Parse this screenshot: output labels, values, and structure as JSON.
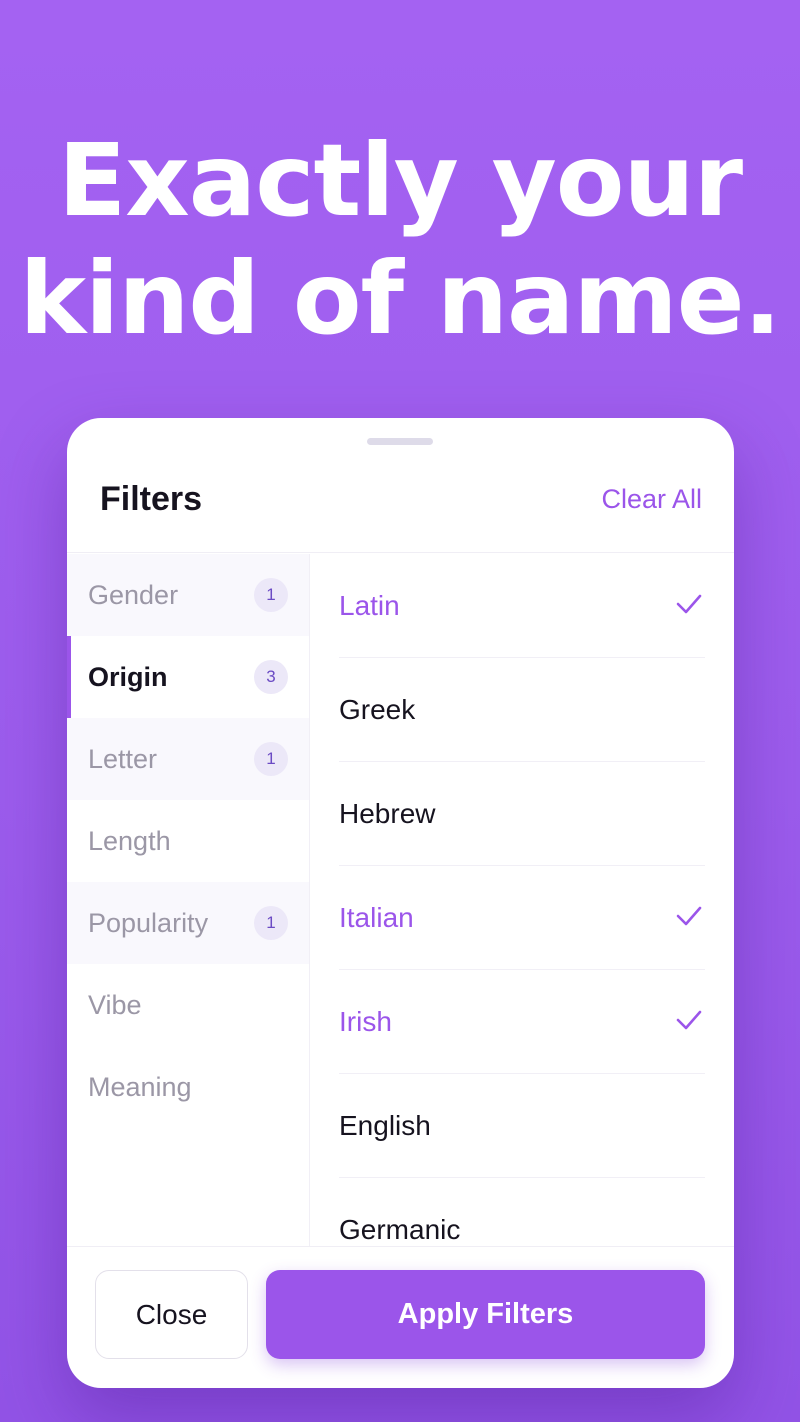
{
  "headline": {
    "line1": "Exactly your",
    "line2": "kind of name."
  },
  "sheet": {
    "title": "Filters",
    "clear_all": "Clear All"
  },
  "categories": [
    {
      "label": "Gender",
      "count": "1",
      "active": false
    },
    {
      "label": "Origin",
      "count": "3",
      "active": true
    },
    {
      "label": "Letter",
      "count": "1",
      "active": false
    },
    {
      "label": "Length",
      "count": "",
      "active": false
    },
    {
      "label": "Popularity",
      "count": "1",
      "active": false
    },
    {
      "label": "Vibe",
      "count": "",
      "active": false
    },
    {
      "label": "Meaning",
      "count": "",
      "active": false
    }
  ],
  "options": [
    {
      "label": "Latin",
      "selected": true
    },
    {
      "label": "Greek",
      "selected": false
    },
    {
      "label": "Hebrew",
      "selected": false
    },
    {
      "label": "Italian",
      "selected": true
    },
    {
      "label": "Irish",
      "selected": true
    },
    {
      "label": "English",
      "selected": false
    },
    {
      "label": "Germanic",
      "selected": false
    }
  ],
  "footer": {
    "close_label": "Close",
    "apply_label": "Apply Filters"
  },
  "colors": {
    "accent": "#9b55ea",
    "background": "#a462f2",
    "text": "#16131f",
    "muted": "#9b97a6"
  },
  "icons": {
    "selected_marker": "check-icon"
  }
}
